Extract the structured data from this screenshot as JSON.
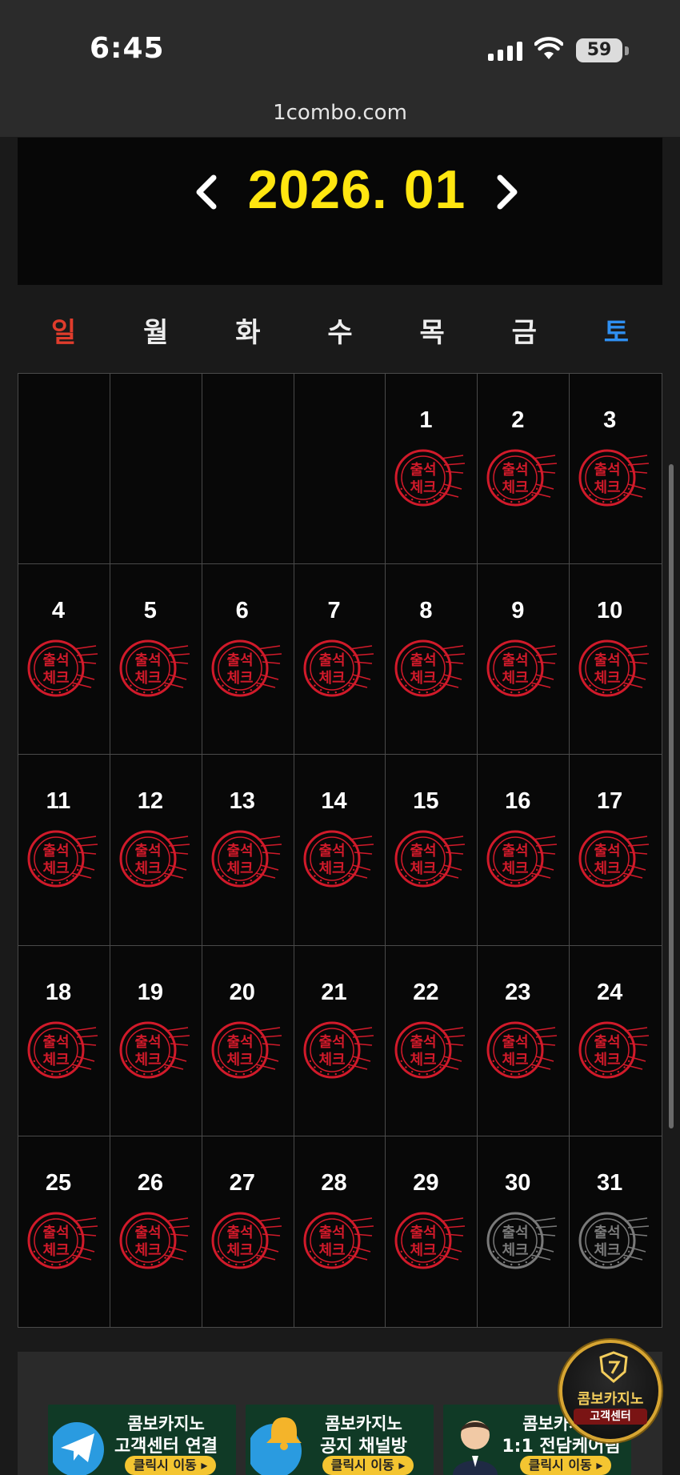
{
  "status_bar": {
    "time": "6:45",
    "battery": "59"
  },
  "browser": {
    "url": "1combo.com"
  },
  "calendar": {
    "month_title": "2026. 01",
    "weekdays": [
      "일",
      "월",
      "화",
      "수",
      "목",
      "금",
      "토"
    ],
    "stamp_text": {
      "line1": "출석",
      "line2": "체크"
    },
    "colors": {
      "checked": "#d11a2a",
      "unchecked": "#7a7a7a",
      "title": "#ffe610",
      "sunday": "#e03c2c",
      "saturday": "#2f8ff0"
    },
    "cells": [
      {
        "day": "",
        "status": "empty"
      },
      {
        "day": "",
        "status": "empty"
      },
      {
        "day": "",
        "status": "empty"
      },
      {
        "day": "",
        "status": "empty"
      },
      {
        "day": "1",
        "status": "checked"
      },
      {
        "day": "2",
        "status": "checked"
      },
      {
        "day": "3",
        "status": "checked"
      },
      {
        "day": "4",
        "status": "checked"
      },
      {
        "day": "5",
        "status": "checked"
      },
      {
        "day": "6",
        "status": "checked"
      },
      {
        "day": "7",
        "status": "checked"
      },
      {
        "day": "8",
        "status": "checked"
      },
      {
        "day": "9",
        "status": "checked"
      },
      {
        "day": "10",
        "status": "checked"
      },
      {
        "day": "11",
        "status": "checked"
      },
      {
        "day": "12",
        "status": "checked"
      },
      {
        "day": "13",
        "status": "checked"
      },
      {
        "day": "14",
        "status": "checked"
      },
      {
        "day": "15",
        "status": "checked"
      },
      {
        "day": "16",
        "status": "checked"
      },
      {
        "day": "17",
        "status": "checked"
      },
      {
        "day": "18",
        "status": "checked"
      },
      {
        "day": "19",
        "status": "checked"
      },
      {
        "day": "20",
        "status": "checked"
      },
      {
        "day": "21",
        "status": "checked"
      },
      {
        "day": "22",
        "status": "checked"
      },
      {
        "day": "23",
        "status": "checked"
      },
      {
        "day": "24",
        "status": "checked"
      },
      {
        "day": "25",
        "status": "checked"
      },
      {
        "day": "26",
        "status": "checked"
      },
      {
        "day": "27",
        "status": "checked"
      },
      {
        "day": "28",
        "status": "checked"
      },
      {
        "day": "29",
        "status": "checked"
      },
      {
        "day": "30",
        "status": "unchecked"
      },
      {
        "day": "31",
        "status": "unchecked"
      }
    ]
  },
  "banners": [
    {
      "title": "콤보카지노",
      "subtitle": "고객센터 연결",
      "button": "클릭시 이동 ▸",
      "icon": "telegram-icon"
    },
    {
      "title": "콤보카지노",
      "subtitle": "공지 채널방",
      "button": "클릭시 이동 ▸",
      "icon": "bell-icon"
    },
    {
      "title": "콤보카지노",
      "subtitle": "1:1 전담케어팀",
      "button": "클릭시 이동 ▸",
      "icon": "agent-icon"
    }
  ],
  "float_badge": {
    "title": "콤보카지노",
    "subtitle": "고객센터",
    "icon": "shield-logo-icon"
  }
}
